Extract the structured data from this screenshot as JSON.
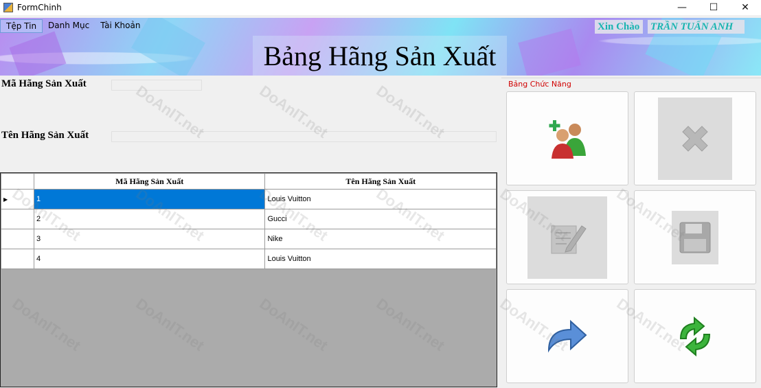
{
  "window": {
    "title": "FormChinh",
    "minimize_glyph": "—",
    "maximize_glyph": "☐",
    "close_glyph": "✕"
  },
  "menu": {
    "items": [
      {
        "label": "Tệp Tin",
        "active": true
      },
      {
        "label": "Danh Mục",
        "active": false
      },
      {
        "label": "Tài Khoản",
        "active": false
      }
    ]
  },
  "header": {
    "title": "Bảng Hãng Sản Xuất",
    "greeting": "Xin Chào",
    "user_name": "TRẦN TUẤN ANH"
  },
  "form": {
    "ma_label": "Mã Hãng Sản Xuất",
    "ma_value": "",
    "ten_label": "Tên Hãng Sản Xuất",
    "ten_value": ""
  },
  "grid": {
    "columns": [
      "Mã Hãng Sản Xuất",
      "Tên Hãng Sản Xuất"
    ],
    "rows": [
      {
        "ma": "1",
        "ten": "Louis Vuitton"
      },
      {
        "ma": "2",
        "ten": "Gucci"
      },
      {
        "ma": "3",
        "ten": "Nike"
      },
      {
        "ma": "4",
        "ten": "Louis Vuitton"
      }
    ],
    "selected_row": 0,
    "row_marker": "▶"
  },
  "panel": {
    "label": "Bảng Chức Năng",
    "buttons": [
      {
        "name": "add",
        "icon": "add-users-icon",
        "enabled": true
      },
      {
        "name": "delete",
        "icon": "delete-x-icon",
        "enabled": false
      },
      {
        "name": "edit",
        "icon": "edit-pencil-icon",
        "enabled": false
      },
      {
        "name": "save",
        "icon": "save-floppy-icon",
        "enabled": false
      },
      {
        "name": "back",
        "icon": "back-arrow-icon",
        "enabled": true
      },
      {
        "name": "refresh",
        "icon": "refresh-icon",
        "enabled": true
      }
    ]
  },
  "watermark": "DoAnIT.net",
  "colors": {
    "selection": "#0078d7",
    "greeting_text": "#18b4b0",
    "panel_label": "#d00000",
    "grid_empty": "#ababab"
  }
}
